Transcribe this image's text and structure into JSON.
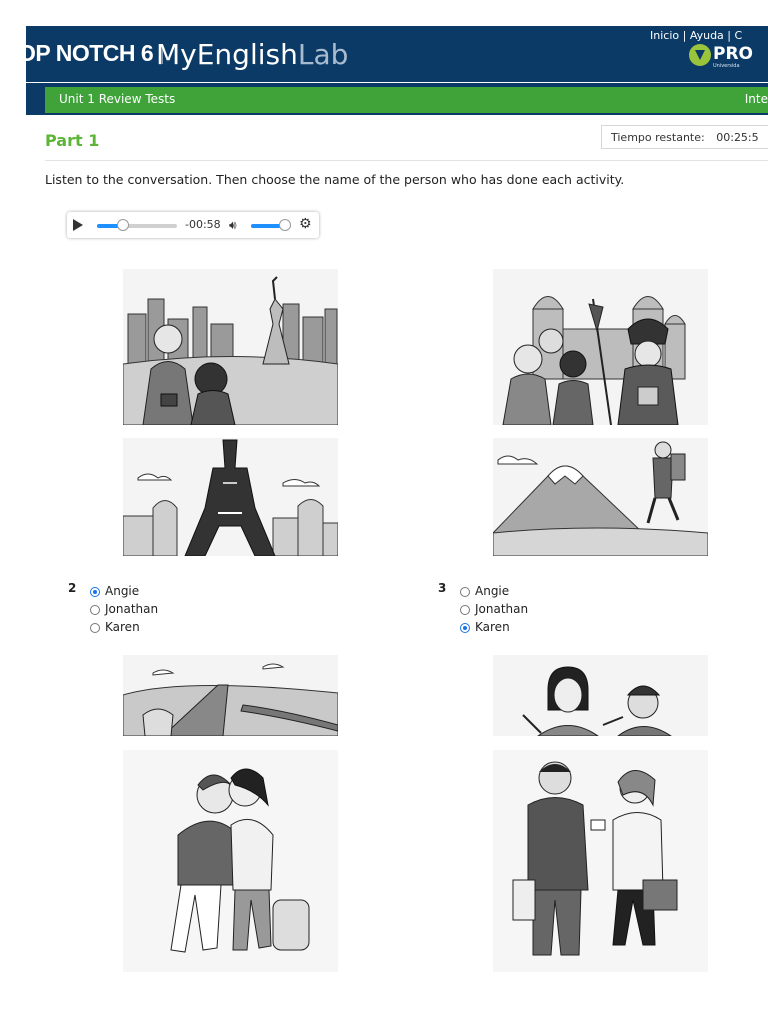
{
  "header": {
    "brand": "OP NOTCH 6",
    "app_name_1": "MyEnglish",
    "app_name_2": "Lab",
    "links": [
      "Inicio",
      "Ayuda",
      "C"
    ],
    "logo_text": "PRO",
    "logo_subtext": "Universida"
  },
  "nav": {
    "title": "Unit 1 Review Tests",
    "right_label": "Inte"
  },
  "part_title": "Part 1",
  "timer": {
    "label": "Tiempo restante:",
    "value": "00:25:5"
  },
  "instructions": "Listen to the conversation. Then choose the name of the person who has done each activity.",
  "audio": {
    "time": "-00:58",
    "progress": 0.33,
    "volume": 0.85
  },
  "questions": [
    {
      "number": "2",
      "options": [
        {
          "label": "Angie",
          "selected": true
        },
        {
          "label": "Jonathan",
          "selected": false
        },
        {
          "label": "Karen",
          "selected": false
        }
      ]
    },
    {
      "number": "3",
      "options": [
        {
          "label": "Angie",
          "selected": false
        },
        {
          "label": "Jonathan",
          "selected": false
        },
        {
          "label": "Karen",
          "selected": true
        }
      ]
    }
  ],
  "colors": {
    "header_bg": "#0b3a66",
    "nav_green": "#3fa33a",
    "part_green": "#5db538",
    "radio_blue": "#1a73e8"
  }
}
